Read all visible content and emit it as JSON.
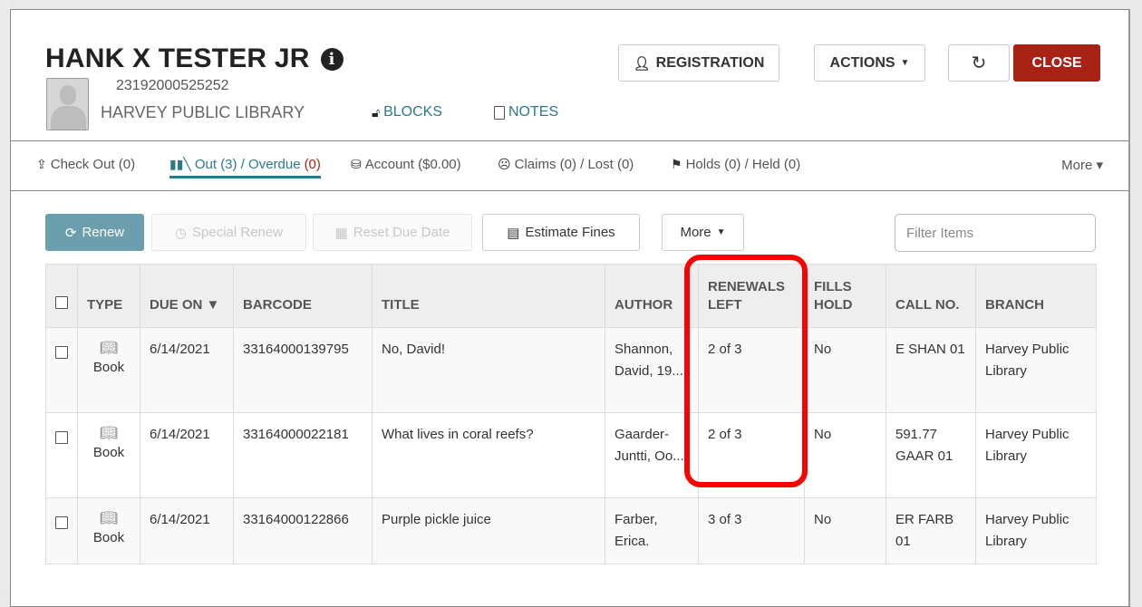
{
  "patron": {
    "name": "HANK X TESTER JR",
    "barcode": "23192000525252",
    "library": "HARVEY PUBLIC LIBRARY",
    "links": {
      "blocks": "BLOCKS",
      "notes": "NOTES"
    }
  },
  "header_buttons": {
    "registration": "REGISTRATION",
    "actions": "ACTIONS",
    "refresh": "↻",
    "close": "CLOSE"
  },
  "tabs": [
    {
      "label": "Check Out (0)",
      "active": false
    },
    {
      "label": "Out (3) / Overdue ",
      "suffix": "(0)",
      "active": true
    },
    {
      "label": "Account ($0.00)",
      "active": false
    },
    {
      "label": "Claims (0) / Lost (0)",
      "active": false
    },
    {
      "label": "Holds (0) / Held (0)",
      "active": false
    }
  ],
  "tabs_more": "More ▾",
  "toolbar": {
    "renew": "Renew",
    "special_renew": "Special Renew",
    "reset_due_date": "Reset Due Date",
    "estimate_fines": "Estimate Fines",
    "more": "More",
    "filter_placeholder": "Filter Items"
  },
  "table": {
    "columns": [
      "TYPE",
      "DUE ON ▼",
      "BARCODE",
      "TITLE",
      "AUTHOR",
      "RENEWALS LEFT",
      "FILLS HOLD",
      "CALL NO.",
      "BRANCH"
    ],
    "rows": [
      {
        "type": "Book",
        "due_on": "6/14/2021",
        "barcode": "33164000139795",
        "title": "No, David!",
        "author": "Shannon, David, 19...",
        "renewals_left": "2 of 3",
        "fills_hold": "No",
        "call_no": "E SHAN 01",
        "branch": "Harvey Public Library"
      },
      {
        "type": "Book",
        "due_on": "6/14/2021",
        "barcode": "33164000022181",
        "title": "What lives in coral reefs?",
        "author": "Gaarder-Juntti, Oo...",
        "renewals_left": "2 of 3",
        "fills_hold": "No",
        "call_no": "591.77 GAAR 01",
        "branch": "Harvey Public Library"
      },
      {
        "type": "Book",
        "due_on": "6/14/2021",
        "barcode": "33164000122866",
        "title": "Purple pickle juice",
        "author": "Farber, Erica.",
        "renewals_left": "3 of 3",
        "fills_hold": "No",
        "call_no": "ER FARB 01",
        "branch": "Harvey Public Library"
      }
    ]
  },
  "colors": {
    "accent": "#2a7a8c",
    "close_button": "#a82315",
    "renew_button": "#6c9fae",
    "overdue_count": "#a82315",
    "annotation": "#ff0000"
  }
}
